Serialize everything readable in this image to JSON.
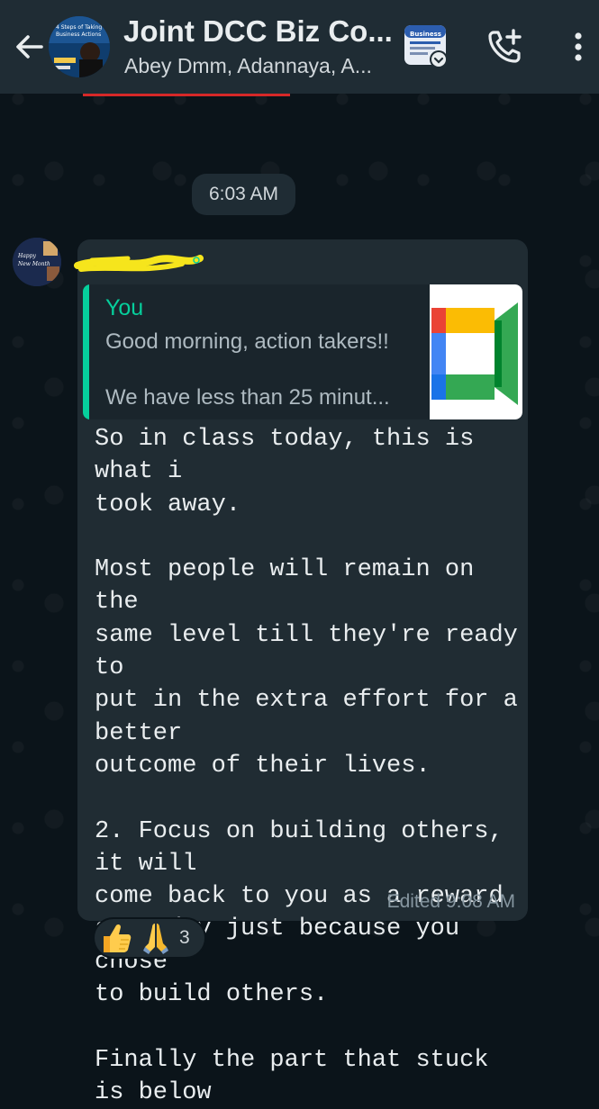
{
  "header": {
    "title": "Joint DCC Biz Co...",
    "subtitle": "Abey Dmm, Adannaya, A...",
    "group_avatar_text": [
      "4 Steps of Taking",
      "Business Actions"
    ],
    "business_icon_text": "Business"
  },
  "chat": {
    "time_chip": "6:03 AM",
    "message": {
      "sender_avatar_text": [
        "Happy",
        "New Month"
      ],
      "reply": {
        "author": "You",
        "line1": "Good morning, action takers!!",
        "line2": "We have less than 25 minut...",
        "thumbnail_icon": "google-meet-icon"
      },
      "text": "So in class today, this is what i\ntook away.\n\nMost people will remain on the\nsame level till they're ready to\nput in the extra effort for a better\noutcome of their lives.\n\n2. Focus on building others, it will\ncome back to you as a reward\nsome day just because you chose\nto build others.\n\nFinally the part that stuck is below",
      "meta": "Edited 9:08 AM"
    },
    "reactions": {
      "emojis": [
        "thumbs-up-icon",
        "folded-hands-icon"
      ],
      "count": "3"
    }
  },
  "colors": {
    "header_bg": "#1f2c34",
    "bubble_bg": "#202c33",
    "accent_green": "#06cf9c",
    "wallpaper": "#0b141a",
    "highlight_yellow": "#f6e51c"
  }
}
